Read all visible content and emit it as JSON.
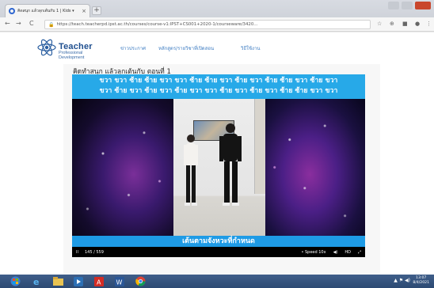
{
  "browser": {
    "tab_title": "คิดสนุก แล้วลุกเต้นกับ 1 | Kids ▾",
    "tab_close": "×",
    "new_tab": "+",
    "url": "https://teach.teacherpd.ipst.ac.th/courses/course-v1:IPST+CS001+2020-1/courseware/3420...",
    "nav": {
      "back": "←",
      "forward": "→",
      "reload": "C"
    }
  },
  "site": {
    "logo_line1": "Teacher",
    "logo_line2": "Professional",
    "logo_line3": "Development",
    "menu": [
      "ข่าวประกาศ",
      "หลักสูตร/รายวิชาที่เปิดสอน",
      "วิธีใช้งาน"
    ]
  },
  "lesson": {
    "title": "คิดทำสนุก แล้วลุกเต้นกับ ตอนที่ 1"
  },
  "video": {
    "caption_top": [
      "ขวา ขวา ซ้าย ซ้าย ขวา ขวา ซ้าย ซ้าย ขวา ซ้าย ขวา ซ้าย ซ้าย ขวา ซ้าย ขวา",
      "ขวา ซ้าย ขวา ซ้าย ขวา ซ้าย ขวา ขวา ซ้าย ขวา ซ้าย ขวา ซ้าย ซ้าย ขวา ขวา"
    ],
    "caption_bottom": "เต้นตามจังหวะที่กำหนด",
    "controls": {
      "play": "II",
      "time": "145 / 559",
      "speed": "• Speed 10x",
      "volume": "◀)",
      "quality": "HD",
      "fullscreen": "⤢"
    }
  },
  "taskbar": {
    "items": [
      "windows-start-icon",
      "ie-icon",
      "file-explorer-icon",
      "media-player-icon",
      "acrobat-icon",
      "word-icon",
      "chrome-icon"
    ],
    "clock_time": "13:07",
    "clock_date": "8/4/2021"
  }
}
